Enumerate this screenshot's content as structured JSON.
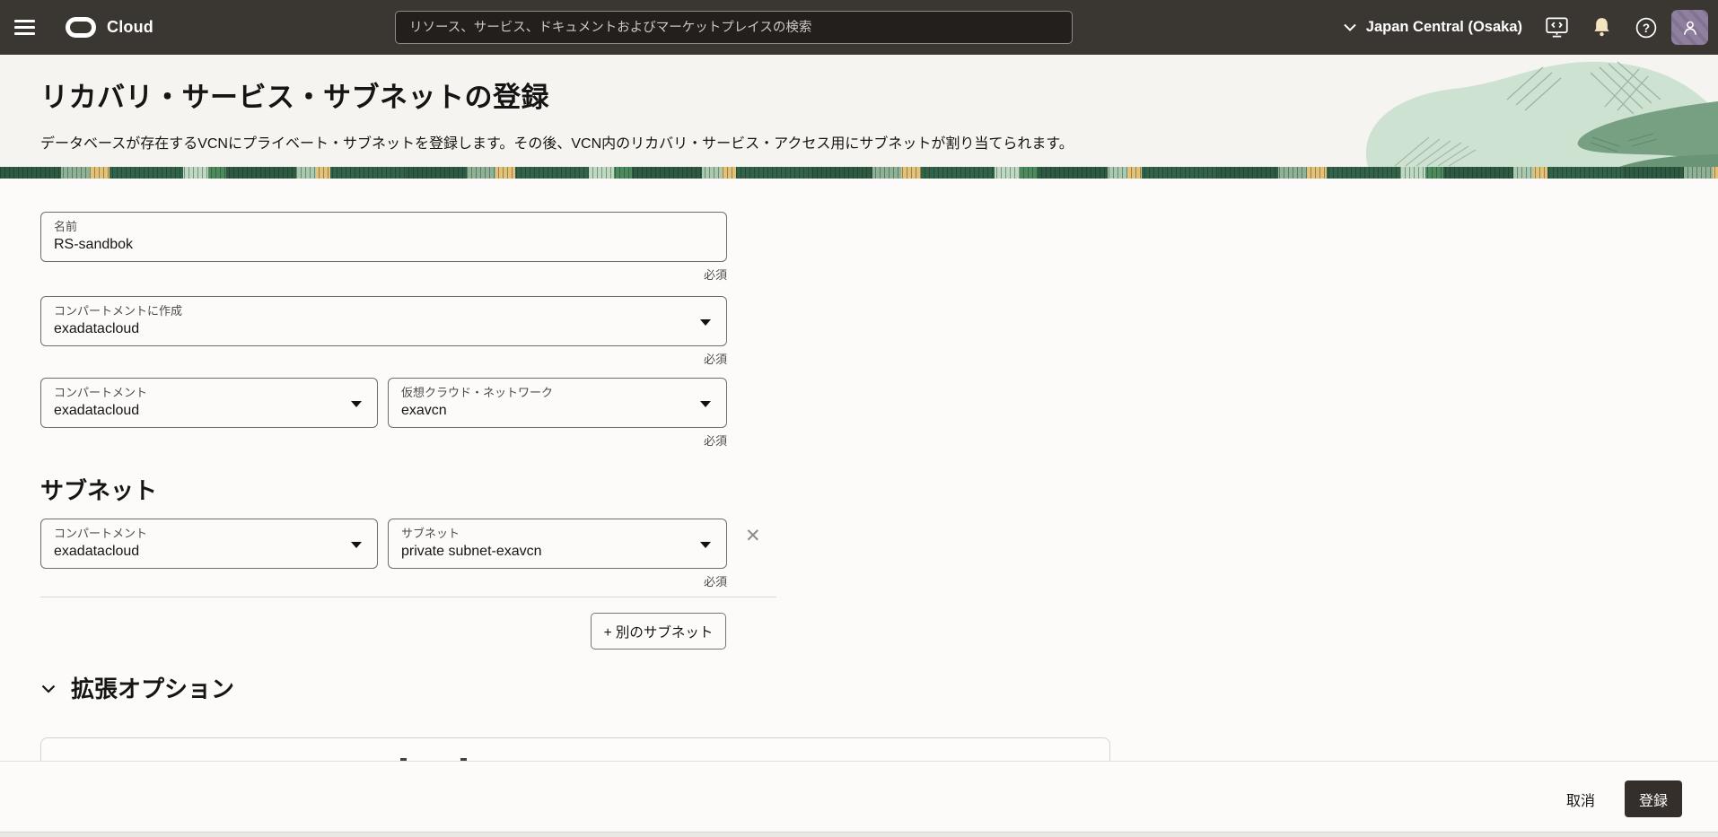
{
  "topbar": {
    "brand": "Cloud",
    "search_placeholder": "リソース、サービス、ドキュメントおよびマーケットプレイスの検索",
    "region_label": "Japan Central (Osaka)"
  },
  "page": {
    "title": "リカバリ・サービス・サブネットの登録",
    "description": "データベースが存在するVCNにプライベート・サブネットを登録します。その後、VCN内のリカバリ・サービス・アクセス用にサブネットが割り当てられます。"
  },
  "form": {
    "required": "必須",
    "name": {
      "label": "名前",
      "value": "RS-sandbok"
    },
    "create_in_compartment": {
      "label": "コンパートメントに作成",
      "value": "exadatacloud"
    },
    "compartment": {
      "label": "コンパートメント",
      "value": "exadatacloud"
    },
    "vcn": {
      "label": "仮想クラウド・ネットワーク",
      "value": "exavcn"
    },
    "subnets": {
      "heading": "サブネット",
      "rows": [
        {
          "compartment": {
            "label": "コンパートメント",
            "value": "exadatacloud"
          },
          "subnet": {
            "label": "サブネット",
            "value": "private subnet-exavcn"
          }
        }
      ],
      "add_another": "+ 別のサブネット"
    },
    "advanced": "拡張オプション"
  },
  "footer": {
    "cancel": "取消",
    "submit": "登録"
  },
  "icons": {
    "remove": "✕",
    "help": "?"
  },
  "colors": {
    "topbar_bg": "#3a3631",
    "header_bg": "#f5f4f1",
    "band_green": "#33624a",
    "primary_button": "#342f2a",
    "avatar_purple": "#8d7ea1",
    "bell_cream": "#f4e4c0"
  }
}
